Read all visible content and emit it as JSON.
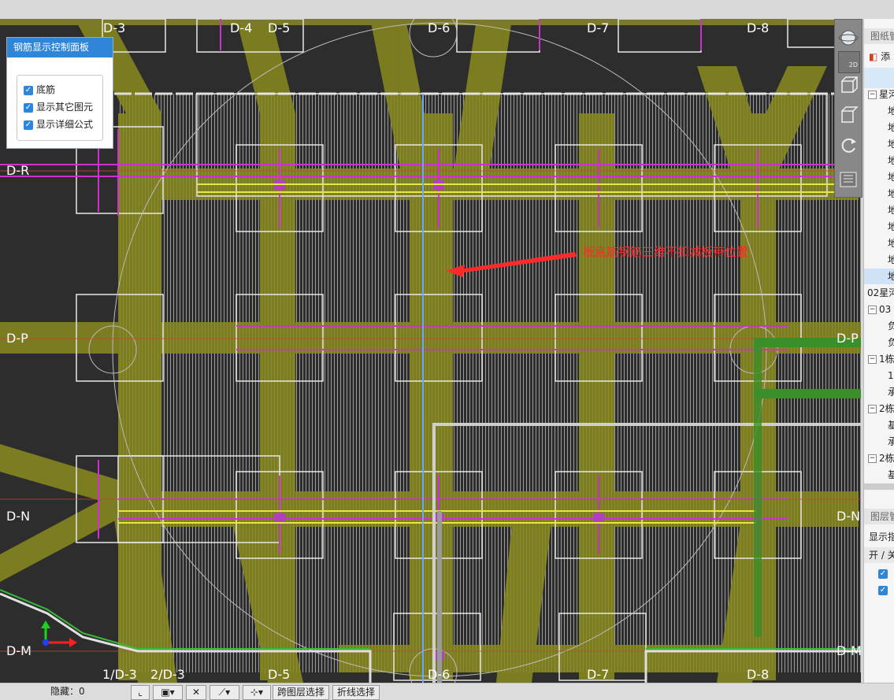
{
  "control_panel": {
    "title": "钢筋显示控制面板",
    "options": [
      {
        "label": "底筋",
        "checked": true
      },
      {
        "label": "显示其它图元",
        "checked": true
      },
      {
        "label": "显示详细公式",
        "checked": true
      }
    ]
  },
  "canvas": {
    "annotation": "板底筋钢筋三维不扣减板带位置",
    "axis_labels": {
      "top": [
        "D-3",
        "D-4",
        "D-5",
        "D-6",
        "D-7",
        "D-8"
      ],
      "left": [
        "D-R",
        "D-P",
        "D-N",
        "D-M"
      ],
      "right": [
        "D-P",
        "D-N",
        "D-M"
      ],
      "bottom": [
        "1/D-3",
        "2/D-3",
        "D-5",
        "D-6",
        "D-7",
        "D-8"
      ]
    }
  },
  "view_toolbar": {
    "icons": [
      "orbit-icon",
      "2d-view-icon",
      "3d-view-icon",
      "box-view-icon",
      "rotate-icon",
      "layout-icon"
    ],
    "label_2d": "2D"
  },
  "right_panel": {
    "drawing_manager_title": "图纸管",
    "add_label": "添",
    "tree": [
      {
        "text": "星河",
        "kind": "group"
      },
      {
        "text": "地",
        "kind": "leaf"
      },
      {
        "text": "地",
        "kind": "leaf"
      },
      {
        "text": "地",
        "kind": "leaf"
      },
      {
        "text": "地",
        "kind": "leaf"
      },
      {
        "text": "地",
        "kind": "leaf"
      },
      {
        "text": "地",
        "kind": "leaf"
      },
      {
        "text": "地",
        "kind": "leaf"
      },
      {
        "text": "地",
        "kind": "leaf"
      },
      {
        "text": "地",
        "kind": "leaf"
      },
      {
        "text": "地",
        "kind": "leaf"
      },
      {
        "text": "地",
        "kind": "selected"
      },
      {
        "text": "02星河",
        "kind": "plain"
      },
      {
        "text": "03",
        "kind": "group"
      },
      {
        "text": "负",
        "kind": "leaf"
      },
      {
        "text": "负",
        "kind": "leaf"
      },
      {
        "text": "1栋",
        "kind": "group"
      },
      {
        "text": "1",
        "kind": "leaf"
      },
      {
        "text": "承",
        "kind": "leaf"
      },
      {
        "text": "2栋",
        "kind": "group"
      },
      {
        "text": "基",
        "kind": "leaf"
      },
      {
        "text": "承",
        "kind": "leaf"
      },
      {
        "text": "2栋",
        "kind": "group"
      },
      {
        "text": "基",
        "kind": "leaf"
      }
    ],
    "layer_manager_title": "图层管",
    "layer_display": "显示指",
    "layer_onoff": "开 / 关"
  },
  "status_bar": {
    "hidden_label": "隐藏：",
    "hidden_value": "0",
    "cross_layer_select": "跨图层选择",
    "polyline_select": "折线选择"
  },
  "colors": {
    "canvas_bg": "#2d2d2d",
    "rebar_band": "#8a8a1e",
    "magenta": "#cc33cc",
    "accent_blue": "#2f86d8",
    "annotation_red": "#ff2a2a"
  }
}
